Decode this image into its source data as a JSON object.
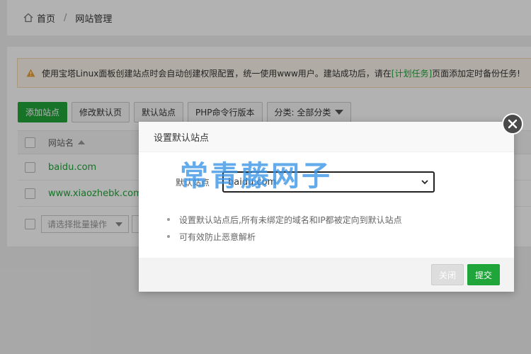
{
  "breadcrumb": {
    "home": "首页",
    "separator": "/",
    "current": "网站管理"
  },
  "alert": {
    "text_before": "使用宝塔Linux面板创建站点时会自动创建权限配置，统一使用www用户。建站成功后，请在",
    "link": "[计划任务]",
    "text_after": "页面添加定时备份任务!"
  },
  "toolbar": {
    "add_site": "添加站点",
    "edit_default_page": "修改默认页",
    "default_site": "默认站点",
    "php_cli_version": "PHP命令行版本",
    "category_filter": "分类: 全部分类"
  },
  "table": {
    "header_site_name": "网站名",
    "rows": [
      {
        "name": "baidu.com"
      },
      {
        "name": "www.xiaozhebk.com"
      }
    ]
  },
  "batch": {
    "placeholder": "请选择批量操作"
  },
  "dialog": {
    "title": "设置默认站点",
    "field_label": "默认站点",
    "selected_value": "baidu.com",
    "notes": [
      "设置默认站点后,所有未绑定的域名和IP都被定向到默认站点",
      "可有效防止恶意解析"
    ],
    "close_label": "关闭",
    "submit_label": "提交"
  },
  "watermark": "常青藤网子",
  "colors": {
    "accent_green": "#20a53a",
    "warning_orange": "#e6a23c"
  },
  "icons": {
    "home": "home-icon",
    "warning": "warning-icon",
    "close": "close-icon",
    "chevron": "chevron-down-icon",
    "sort": "sort-up-icon"
  }
}
